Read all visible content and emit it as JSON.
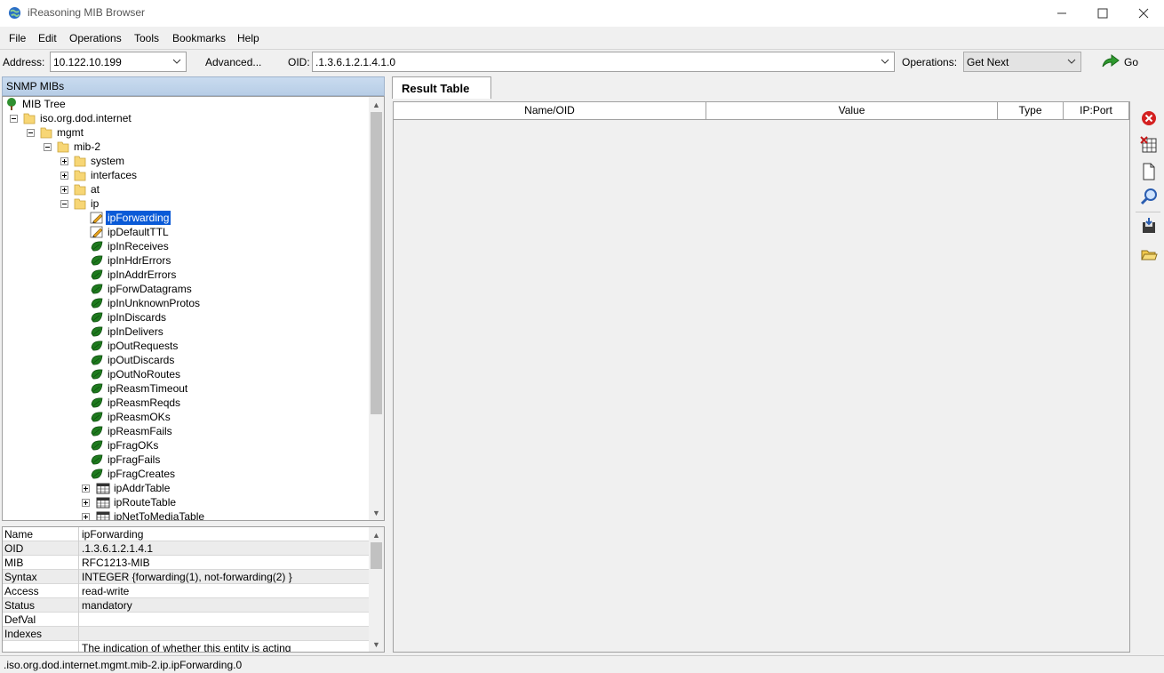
{
  "window": {
    "title": "iReasoning MIB Browser"
  },
  "menu": [
    "File",
    "Edit",
    "Operations",
    "Tools",
    "Bookmarks",
    "Help"
  ],
  "toolbar": {
    "address_label": "Address:",
    "address_value": "10.122.10.199",
    "advanced_label": "Advanced...",
    "oid_label": "OID:",
    "oid_value": ".1.3.6.1.2.1.4.1.0",
    "operations_label": "Operations:",
    "operations_value": "Get Next",
    "go_label": "Go"
  },
  "left_panel": {
    "header": "SNMP MIBs"
  },
  "tree": [
    {
      "label": "MIB Tree",
      "icon": "tree-icon"
    },
    {
      "label": "iso.org.dod.internet",
      "icon": "folder-icon"
    },
    {
      "label": "mgmt",
      "icon": "folder-icon"
    },
    {
      "label": "mib-2",
      "icon": "folder-icon"
    },
    {
      "label": "system",
      "icon": "folder-icon"
    },
    {
      "label": "interfaces",
      "icon": "folder-icon"
    },
    {
      "label": "at",
      "icon": "folder-icon"
    },
    {
      "label": "ip",
      "icon": "folder-icon"
    },
    {
      "label": "ipForwarding",
      "icon": "writable-leaf-icon",
      "selected": true
    },
    {
      "label": "ipDefaultTTL",
      "icon": "writable-leaf-icon"
    },
    {
      "label": "ipInReceives",
      "icon": "leaf-icon"
    },
    {
      "label": "ipInHdrErrors",
      "icon": "leaf-icon"
    },
    {
      "label": "ipInAddrErrors",
      "icon": "leaf-icon"
    },
    {
      "label": "ipForwDatagrams",
      "icon": "leaf-icon"
    },
    {
      "label": "ipInUnknownProtos",
      "icon": "leaf-icon"
    },
    {
      "label": "ipInDiscards",
      "icon": "leaf-icon"
    },
    {
      "label": "ipInDelivers",
      "icon": "leaf-icon"
    },
    {
      "label": "ipOutRequests",
      "icon": "leaf-icon"
    },
    {
      "label": "ipOutDiscards",
      "icon": "leaf-icon"
    },
    {
      "label": "ipOutNoRoutes",
      "icon": "leaf-icon"
    },
    {
      "label": "ipReasmTimeout",
      "icon": "leaf-icon"
    },
    {
      "label": "ipReasmReqds",
      "icon": "leaf-icon"
    },
    {
      "label": "ipReasmOKs",
      "icon": "leaf-icon"
    },
    {
      "label": "ipReasmFails",
      "icon": "leaf-icon"
    },
    {
      "label": "ipFragOKs",
      "icon": "leaf-icon"
    },
    {
      "label": "ipFragFails",
      "icon": "leaf-icon"
    },
    {
      "label": "ipFragCreates",
      "icon": "leaf-icon"
    },
    {
      "label": "ipAddrTable",
      "icon": "table-icon"
    },
    {
      "label": "ipRouteTable",
      "icon": "table-icon"
    },
    {
      "label": "ipNetToMediaTable",
      "icon": "table-icon"
    }
  ],
  "properties": [
    {
      "key": "Name",
      "value": "ipForwarding"
    },
    {
      "key": "OID",
      "value": ".1.3.6.1.2.1.4.1"
    },
    {
      "key": "MIB",
      "value": "RFC1213-MIB"
    },
    {
      "key": "Syntax",
      "value": "INTEGER {forwarding(1), not-forwarding(2) }"
    },
    {
      "key": "Access",
      "value": "read-write"
    },
    {
      "key": "Status",
      "value": "mandatory"
    },
    {
      "key": "DefVal",
      "value": ""
    },
    {
      "key": "Indexes",
      "value": ""
    },
    {
      "key": "",
      "value": "The indication of whether this entity is acting"
    }
  ],
  "result_tab": {
    "label": "Result Table"
  },
  "result_columns": [
    "Name/OID",
    "Value",
    "Type",
    "IP:Port"
  ],
  "side_tools": [
    "delete-icon",
    "clear-table-icon",
    "new-document-icon",
    "search-icon",
    "save-icon",
    "open-folder-icon"
  ],
  "status": {
    "text": ".iso.org.dod.internet.mgmt.mib-2.ip.ipForwarding.0"
  },
  "colors": {
    "selection": "#0a5ad7",
    "header_gradient": "#c9dbef",
    "leaf_green": "#1e7a1e",
    "go_green": "#2e9a2e"
  }
}
